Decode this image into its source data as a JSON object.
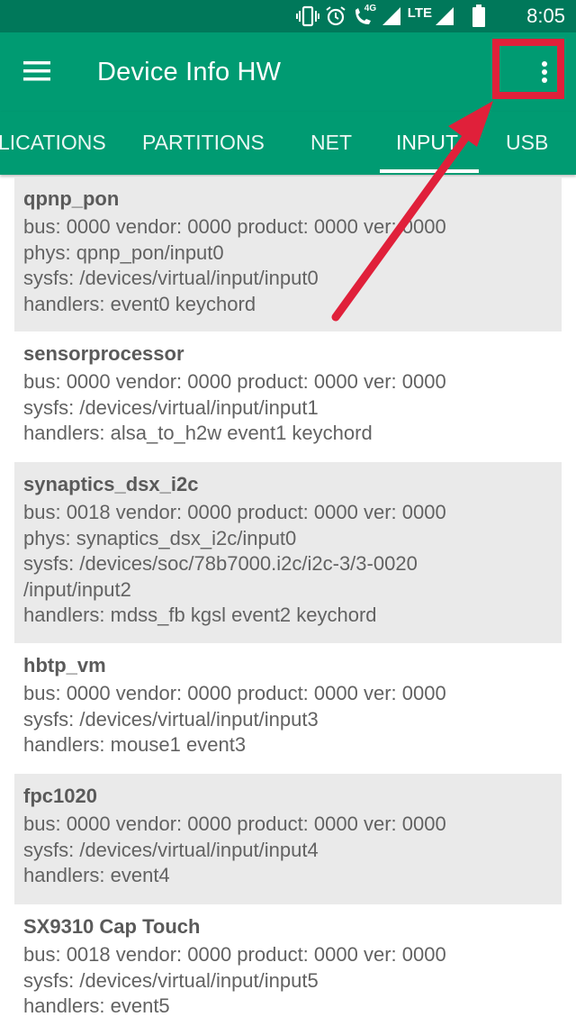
{
  "status_bar": {
    "time": "8:05",
    "network_label": "LTE",
    "signal_badge": "4G",
    "icons": [
      "vibrate-icon",
      "alarm-icon",
      "wifi-calling-icon",
      "signal-icon",
      "signal-icon",
      "battery-icon"
    ]
  },
  "app_bar": {
    "title": "Device Info HW",
    "menu_icon": "hamburger-menu-icon",
    "overflow_icon": "more-vert-icon"
  },
  "tabs": [
    {
      "label": "LICATIONS"
    },
    {
      "label": "PARTITIONS"
    },
    {
      "label": "NET"
    },
    {
      "label": "INPUT",
      "active": true
    },
    {
      "label": "USB"
    }
  ],
  "devices": [
    {
      "name": "qpnp_pon",
      "lines": [
        "bus: 0000 vendor: 0000 product: 0000 ver: 0000",
        "phys: qpnp_pon/input0",
        "sysfs: /devices/virtual/input/input0",
        "handlers: event0 keychord"
      ]
    },
    {
      "name": "sensorprocessor",
      "lines": [
        "bus: 0000 vendor: 0000 product: 0000 ver: 0000",
        "sysfs: /devices/virtual/input/input1",
        "handlers: alsa_to_h2w event1 keychord"
      ]
    },
    {
      "name": "synaptics_dsx_i2c",
      "lines": [
        "bus: 0018 vendor: 0000 product: 0000 ver: 0000",
        "phys: synaptics_dsx_i2c/input0",
        "sysfs: /devices/soc/78b7000.i2c/i2c-3/3-0020",
        "/input/input2",
        "handlers: mdss_fb kgsl event2 keychord"
      ]
    },
    {
      "name": "hbtp_vm",
      "lines": [
        "bus: 0000 vendor: 0000 product: 0000 ver: 0000",
        "sysfs: /devices/virtual/input/input3",
        "handlers: mouse1 event3"
      ]
    },
    {
      "name": "fpc1020",
      "lines": [
        "bus: 0000 vendor: 0000 product: 0000 ver: 0000",
        "sysfs: /devices/virtual/input/input4",
        "handlers: event4"
      ]
    },
    {
      "name": "SX9310 Cap Touch",
      "lines": [
        "bus: 0018 vendor: 0000 product: 0000 ver: 0000",
        "sysfs: /devices/virtual/input/input5",
        "handlers: event5"
      ]
    }
  ],
  "colors": {
    "status_bar": "#00785a",
    "app_bar": "#009b72",
    "card_shaded": "#eaeaea",
    "annotation": "#e0203a"
  }
}
